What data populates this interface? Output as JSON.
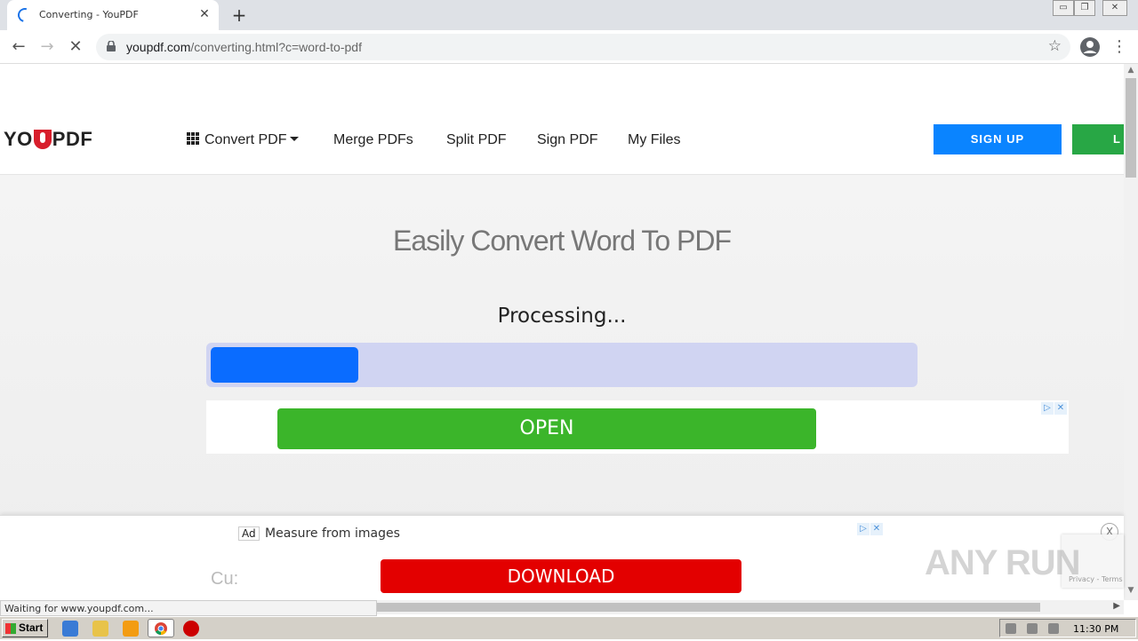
{
  "browser": {
    "tab_title": "Converting - YouPDF",
    "tab_close": "✕",
    "new_tab": "+",
    "url_host": "youpdf.com",
    "url_path": "/converting.html?c=word-to-pdf",
    "status_text": "Waiting for www.youpdf.com...",
    "window_controls": [
      "▭",
      "❐",
      "✕"
    ]
  },
  "site": {
    "logo_left": "YO",
    "logo_right": "PDF",
    "nav": {
      "convert": "Convert PDF",
      "merge": "Merge PDFs",
      "split": "Split PDF",
      "sign": "Sign PDF",
      "files": "My Files"
    },
    "signup": "SIGN UP",
    "login": "L"
  },
  "hero": {
    "title": "Easily Convert Word To PDF",
    "processing": "Processing...",
    "progress": 0.21
  },
  "ads": {
    "open_button": "OPEN",
    "ad_label": "Ad",
    "ad_text": "Measure from images",
    "download_button": "DOWNLOAD",
    "close": "X",
    "partial_text": "Cu:",
    "recaptcha": "Privacy - Terms"
  },
  "watermark": "ANY RUN",
  "taskbar": {
    "start": "Start",
    "clock": "11:30 PM"
  },
  "colors": {
    "signup": "#0a84ff",
    "login": "#28a745",
    "progress_fill": "#0a6cff",
    "progress_track": "#d0d4f2",
    "open": "#3bb52a",
    "download": "#e30000"
  }
}
